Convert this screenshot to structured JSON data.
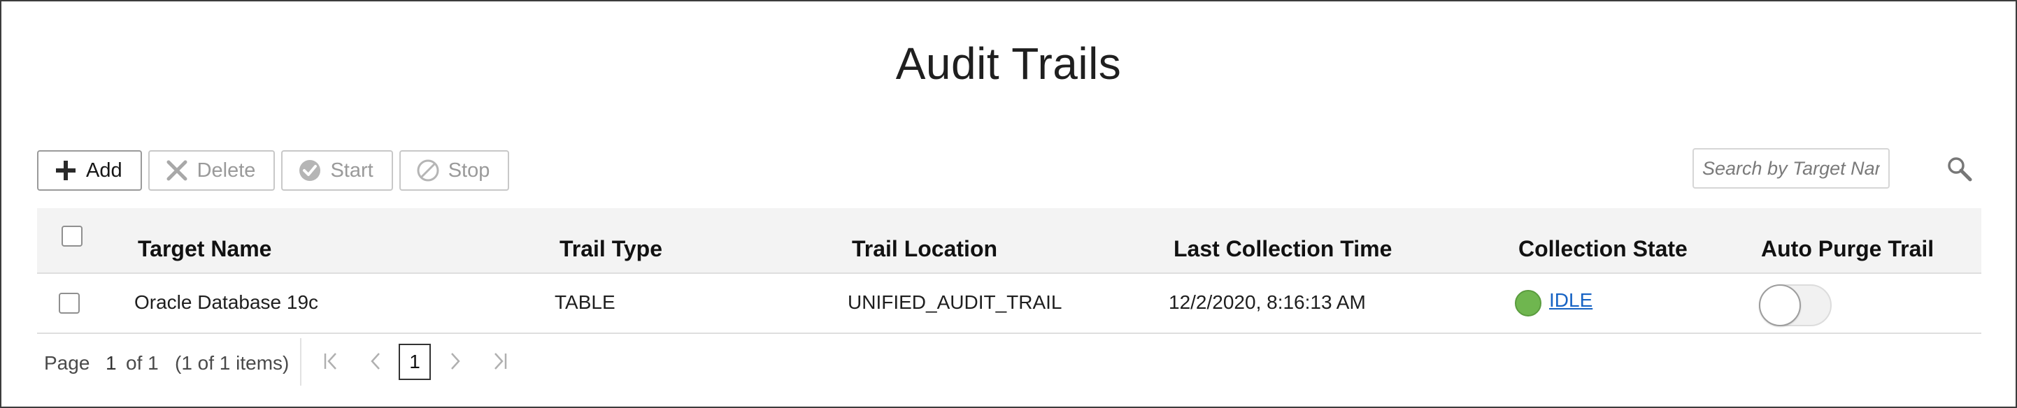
{
  "page": {
    "title": "Audit Trails"
  },
  "toolbar": {
    "add_label": "Add",
    "delete_label": "Delete",
    "start_label": "Start",
    "stop_label": "Stop"
  },
  "search": {
    "placeholder": "Search by Target Name",
    "value": ""
  },
  "table": {
    "columns": [
      "Target Name",
      "Trail Type",
      "Trail Location",
      "Last Collection Time",
      "Collection State",
      "Auto Purge Trail"
    ],
    "rows": [
      {
        "target_name": "Oracle Database 19c",
        "trail_type": "TABLE",
        "trail_location": "UNIFIED_AUDIT_TRAIL",
        "last_collection_time": "12/2/2020, 8:16:13 AM",
        "collection_state": "IDLE",
        "auto_purge": false
      }
    ]
  },
  "pagination": {
    "page_label": "Page",
    "page_number": "1",
    "of_label": "of 1",
    "items_label": "(1 of 1 items)",
    "current_page": "1"
  },
  "colors": {
    "state_idle": "#6fb64f",
    "link": "#1763c4",
    "header_bg": "#f3f3f3"
  }
}
